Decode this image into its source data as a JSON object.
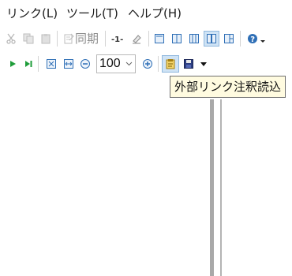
{
  "menu": {
    "items": [
      "リンク(L)",
      "ツール(T)",
      "ヘルプ(H)"
    ]
  },
  "toolbar1": {
    "sync_label": "同期",
    "icons": [
      "cut-icon",
      "copy-icon",
      "paste-icon",
      "sync-icon",
      "line-number-icon",
      "eraser-icon",
      "single-pane-icon",
      "two-column-icon",
      "three-column-icon",
      "split-vertical-icon",
      "split-horizontal-icon",
      "help-icon"
    ]
  },
  "toolbar2": {
    "zoom_value": "100",
    "icons": [
      "play-icon",
      "step-forward-icon",
      "fit-page-icon",
      "fit-width-icon",
      "zoom-out-icon",
      "zoom-in-icon",
      "read-external-annotations-icon",
      "save-icon",
      "dropdown-arrow-icon"
    ]
  },
  "tooltip": {
    "text": "外部リンク注釈読込"
  },
  "colors": {
    "accent": "#2f6fb6",
    "play": "#1f9d3a",
    "tooltip_bg": "#fffbe0",
    "toggle_active": "#cfe3f5",
    "splitter": "#a9a9a9"
  }
}
